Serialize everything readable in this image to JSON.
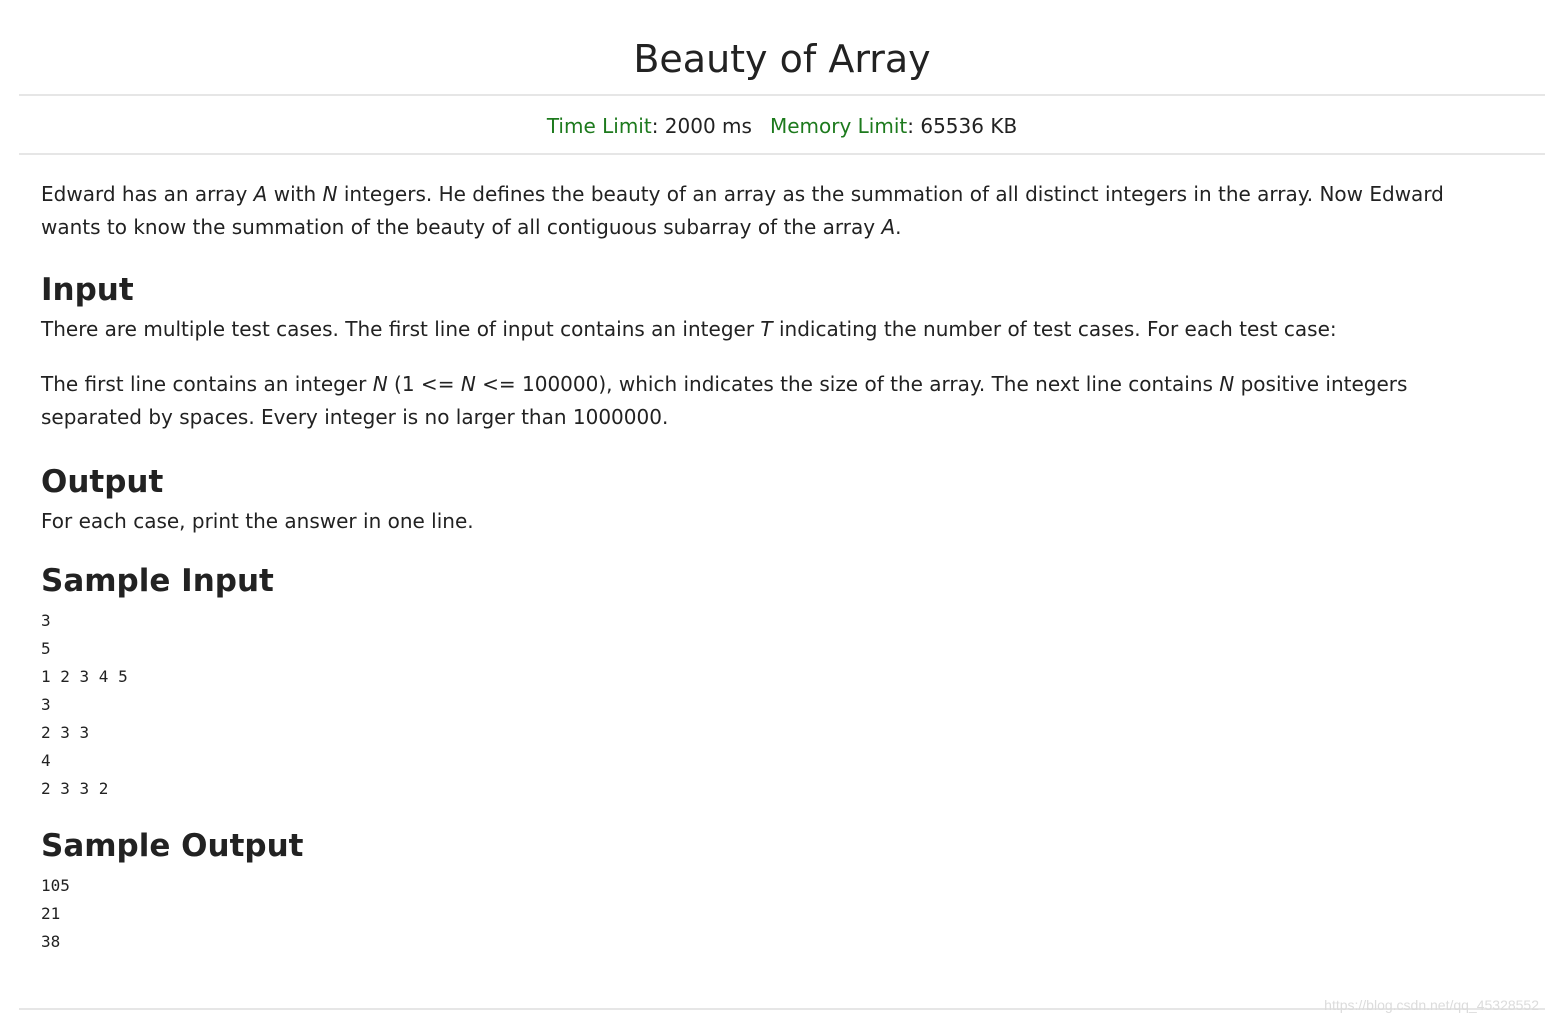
{
  "problem": {
    "title": "Beauty of Array",
    "time_limit_label": "Time Limit",
    "time_limit_value": ": 2000 ms",
    "memory_limit_label": "Memory Limit",
    "memory_limit_value": ": 65536 KB"
  },
  "description": {
    "t1": "Edward has an array ",
    "v1": "A",
    "t2": " with ",
    "v2": "N",
    "t3": " integers. He defines the beauty of an array as the summation of all distinct integers in the array. Now Edward wants to know the summation of the beauty of all contiguous subarray of the array ",
    "v3": "A",
    "t4": "."
  },
  "input": {
    "heading": "Input",
    "p1_t1": "There are multiple test cases. The first line of input contains an integer ",
    "p1_v1": "T",
    "p1_t2": " indicating the number of test cases. For each test case:",
    "p2_t1": "The first line contains an integer ",
    "p2_v1": "N",
    "p2_t2": " (1 <= ",
    "p2_v2": "N",
    "p2_t3": " <= 100000), which indicates the size of the array. The next line contains ",
    "p2_v3": "N",
    "p2_t4": " positive integers separated by spaces. Every integer is no larger than 1000000."
  },
  "output": {
    "heading": "Output",
    "text": "For each case, print the answer in one line."
  },
  "sample_input": {
    "heading": "Sample Input",
    "text": "3\n5\n1 2 3 4 5\n3\n2 3 3\n4\n2 3 3 2"
  },
  "sample_output": {
    "heading": "Sample Output",
    "text": "105\n21\n38"
  },
  "watermark": "https://blog.csdn.net/qq_45328552"
}
